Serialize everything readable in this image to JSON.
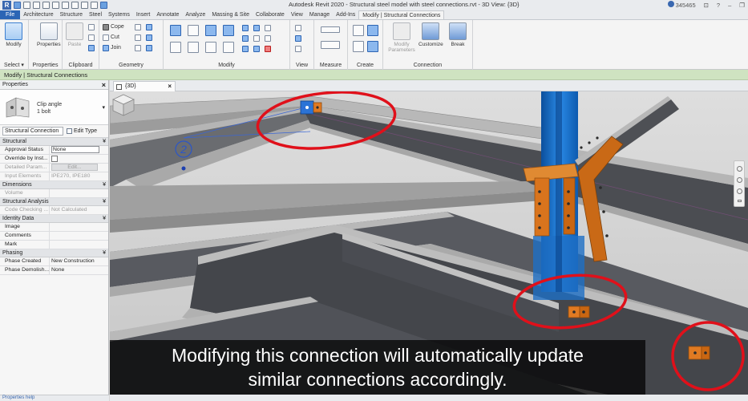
{
  "titlebar": {
    "title": "Autodesk Revit 2020 - Structural steel model with steel connections.rvt - 3D View: {3D}",
    "user_id": "345465"
  },
  "tabs": [
    {
      "label": "File",
      "kind": "file"
    },
    {
      "label": "Architecture"
    },
    {
      "label": "Structure"
    },
    {
      "label": "Steel"
    },
    {
      "label": "Systems"
    },
    {
      "label": "Insert"
    },
    {
      "label": "Annotate"
    },
    {
      "label": "Analyze"
    },
    {
      "label": "Massing & Site"
    },
    {
      "label": "Collaborate"
    },
    {
      "label": "View"
    },
    {
      "label": "Manage"
    },
    {
      "label": "Add-Ins"
    },
    {
      "label": "Modify | Structural Connections",
      "kind": "active"
    }
  ],
  "ribbon": {
    "select": {
      "modify_label": "Modify",
      "panel_label": "Select ▾"
    },
    "properties": {
      "label": "Properties",
      "panel_label": "Properties"
    },
    "clipboard": {
      "paste_label": "Paste",
      "panel_label": "Clipboard"
    },
    "geometry": {
      "cope_label": "Cope",
      "cut_label": "Cut",
      "join_label": "Join",
      "panel_label": "Geometry"
    },
    "modify": {
      "panel_label": "Modify"
    },
    "view": {
      "panel_label": "View"
    },
    "measure": {
      "panel_label": "Measure"
    },
    "create": {
      "panel_label": "Create"
    },
    "connection": {
      "modify_params_label": "Modify Parameters",
      "customize_label": "Customize",
      "break_label": "Break",
      "panel_label": "Connection"
    }
  },
  "context_bar": {
    "text": "Modify | Structural Connections"
  },
  "properties": {
    "title": "Properties",
    "type_name_line1": "Clip angle",
    "type_name_line2": "1 bolt",
    "instance_selector": "Structural Connection",
    "edit_type_label": "Edit Type",
    "groups": {
      "structural": "Structural",
      "dimensions": "Dimensions",
      "structural_analysis": "Structural Analysis",
      "identity_data": "Identity Data",
      "phasing": "Phasing"
    },
    "rows": {
      "approval_status": {
        "key": "Approval Status",
        "value": "None"
      },
      "override": {
        "key": "Override by Inst..."
      },
      "detailed_param": {
        "key": "Detailed Param...",
        "value": "Edit..."
      },
      "input_elements": {
        "key": "Input Elements",
        "value": "IPE270, IPE180"
      },
      "volume": {
        "key": "Volume"
      },
      "code_checking": {
        "key": "Code Checking ...",
        "value": "Not Calculated"
      },
      "image": {
        "key": "Image"
      },
      "comments": {
        "key": "Comments"
      },
      "mark": {
        "key": "Mark"
      },
      "phase_created": {
        "key": "Phase Created",
        "value": "New Construction"
      },
      "phase_demolish": {
        "key": "Phase Demolish...",
        "value": "None"
      }
    },
    "footer": "Properties help"
  },
  "view": {
    "tab_label": "{3D}",
    "tag_number": "2",
    "subtitle_line1": "Modifying this connection will automatically update",
    "subtitle_line2": "similar connections accordingly."
  },
  "colors": {
    "file_tab": "#2b65b5",
    "context_bar": "#cfe3c1",
    "column_blue": "#1f78d1",
    "connection_orange": "#e07a22",
    "highlight_red": "#e0101a",
    "beam_dark": "#4b4d52"
  }
}
